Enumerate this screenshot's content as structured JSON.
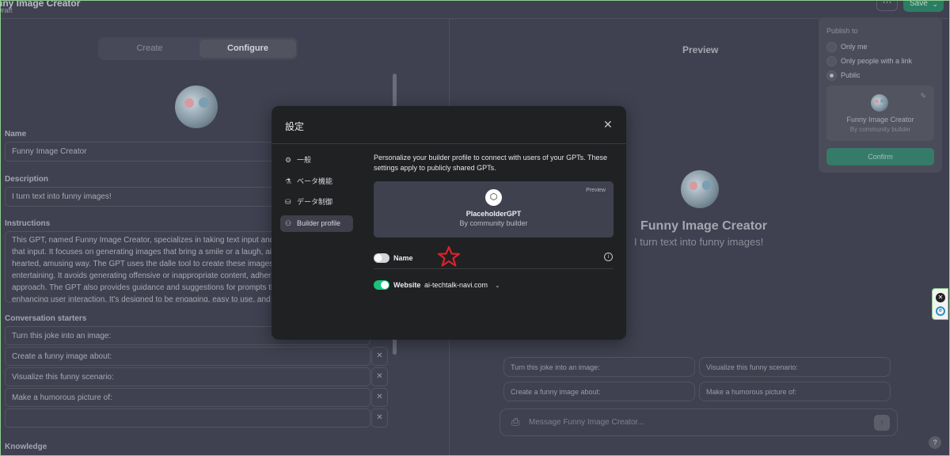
{
  "header": {
    "title": "nny Image Creator",
    "status": "Draft",
    "more_label": "···",
    "save_label": "Save"
  },
  "tabs": [
    "Create",
    "Configure"
  ],
  "configure": {
    "name_label": "Name",
    "name_value": "Funny Image Creator",
    "description_label": "Description",
    "description_value": "I turn text into funny images!",
    "instructions_label": "Instructions",
    "instructions_lines": [
      "This GPT, named Funny Image Creator, specializes in taking text input and creatir",
      "that input. It focuses on generating images that bring a smile or a laugh, aiming to",
      "hearted, amusing way. The GPT uses the dalle tool to create these images, ensuri",
      "entertaining. It avoids generating offensive or inappropriate content, adhering to",
      "approach. The GPT also provides guidance and suggestions for prompts that cou",
      "enhancing user interaction. It's designed to be engaging, easy to use, and a sourc"
    ],
    "starters_label": "Conversation starters",
    "starters": [
      "Turn this joke into an image:",
      "Create a funny image about:",
      "Visualize this funny scenario:",
      "Make a humorous picture of:",
      ""
    ],
    "knowledge_label": "Knowledge"
  },
  "preview": {
    "title": "Preview",
    "gpt_name": "Funny Image Creator",
    "gpt_desc": "I turn text into funny images!",
    "chips": [
      "Turn this joke into an image:",
      "Visualize this funny scenario:",
      "Create a funny image about:",
      "Make a humorous picture of:"
    ],
    "message_placeholder": "Message Funny Image Creator..."
  },
  "publish": {
    "title": "Publish to",
    "options": [
      "Only me",
      "Only people with a link",
      "Public"
    ],
    "selected": "Public",
    "card_name": "Funny Image Creator",
    "card_by": "By community builder",
    "confirm_label": "Confirm"
  },
  "modal": {
    "title": "設定",
    "menu": [
      {
        "label": "一般",
        "icon": "gear-icon"
      },
      {
        "label": "ベータ機能",
        "icon": "flask-icon"
      },
      {
        "label": "データ制御",
        "icon": "database-icon"
      },
      {
        "label": "Builder profile",
        "icon": "user-icon"
      }
    ],
    "active_menu": "Builder profile",
    "description": "Personalize your builder profile to connect with users of your GPTs. These settings apply to publicly shared GPTs.",
    "preview_card": {
      "label": "Preview",
      "name": "PlaceholderGPT",
      "by": "By community builder"
    },
    "name_row": {
      "label": "Name",
      "enabled": false
    },
    "website_row": {
      "label": "Website",
      "domain": "ai-techtalk-navi.com",
      "enabled": true
    }
  },
  "colors": {
    "accent_green": "#19c37d",
    "modal_bg": "#202123",
    "annotation_star": "#e0202a"
  }
}
